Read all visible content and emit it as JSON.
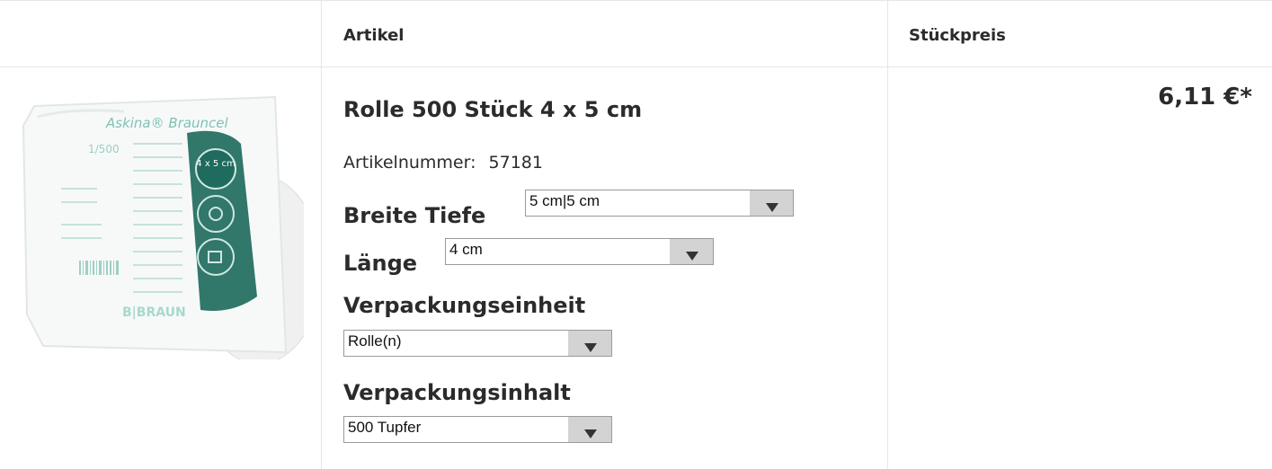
{
  "table": {
    "header": {
      "article": "Artikel",
      "unit_price": "Stückpreis"
    }
  },
  "product": {
    "title": "Rolle 500 Stück 4 x 5 cm",
    "article_number_label": "Artikelnummer:",
    "article_number": "57181",
    "image_text": {
      "brand_line": "Askina® Brauncel",
      "size_label": "4 x 5 cm",
      "count": "1/500",
      "maker": "B|BRAUN"
    },
    "options": {
      "breite_tiefe": {
        "label": "Breite Tiefe",
        "value": "5 cm|5 cm"
      },
      "laenge": {
        "label": "Länge",
        "value": "4 cm"
      },
      "verpackungseinheit": {
        "label": "Verpackungseinheit",
        "value": "Rolle(n)"
      },
      "verpackungsinhalt": {
        "label": "Verpackungsinhalt",
        "value": "500 Tupfer"
      }
    },
    "price": "6,11 €*"
  },
  "colors": {
    "border": "#e6e6e6",
    "teal": "#1f6b5d",
    "select_button": "#d3d3d3"
  }
}
